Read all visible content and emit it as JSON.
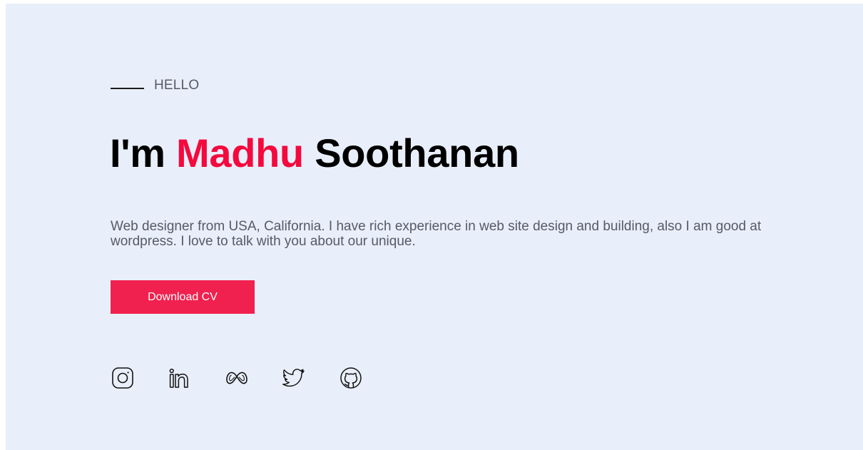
{
  "hero": {
    "eyebrow": "HELLO",
    "title_prefix": "I'm ",
    "title_highlight": "Madhu",
    "title_suffix": " Soothanan",
    "description": "Web designer from USA, California. I have rich experience in web site design and building, also I am good at wordpress. I love to talk with you about our unique.",
    "cta_label": "Download CV"
  },
  "socials": [
    {
      "icon": "instagram-icon"
    },
    {
      "icon": "linkedin-icon"
    },
    {
      "icon": "meta-icon"
    },
    {
      "icon": "twitter-icon"
    },
    {
      "icon": "github-icon"
    }
  ],
  "colors": {
    "background": "#e9effa",
    "accent": "#f5093d",
    "button": "#f0214e",
    "text_muted": "#555a66",
    "text_dark": "#000000"
  }
}
